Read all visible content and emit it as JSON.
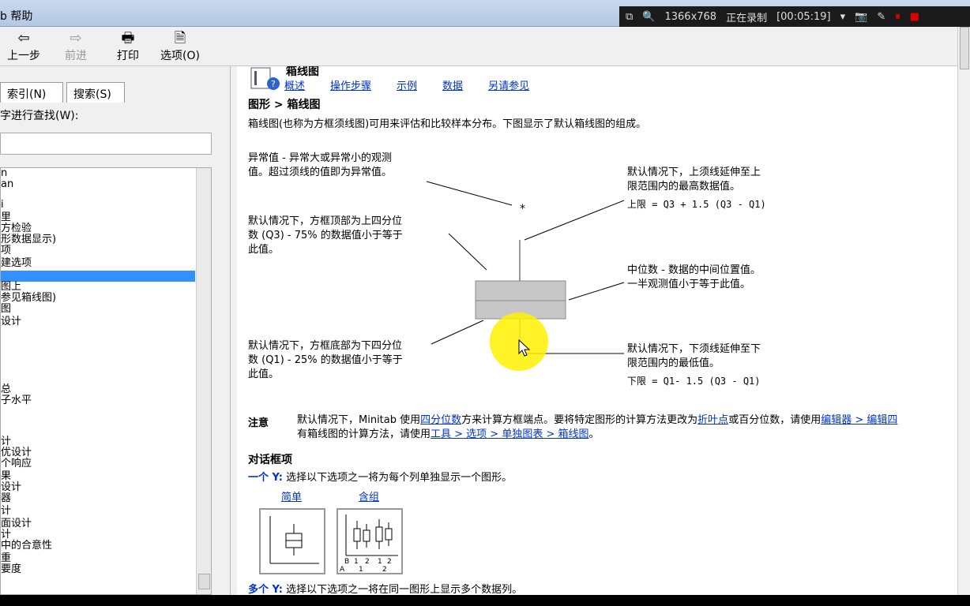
{
  "window": {
    "title": "b 帮助"
  },
  "recorder": {
    "resolution": "1366x768",
    "status": "正在录制",
    "elapsed": "[00:05:19]"
  },
  "toolbar": {
    "back": "上一步",
    "forward": "前进",
    "print": "打印",
    "options": "选项(O)"
  },
  "left": {
    "tabs": [
      "索引(N)",
      "搜索(S)"
    ],
    "find_label": "字进行查找(W):",
    "items": [
      "n",
      "an",
      "i",
      "里",
      "方检验",
      "形数据显示)",
      "项",
      "建选项",
      "",
      "图上",
      "参见箱线图)",
      "图",
      "设计",
      "",
      "总",
      "子水平",
      "",
      "计",
      "优设计",
      "个响应",
      "果",
      "设计",
      "器",
      "计",
      "面设计",
      "计",
      "中的合意性",
      "重",
      "要度"
    ]
  },
  "content": {
    "page_title": "箱线图",
    "nav": [
      "概述",
      "操作步骤",
      "示例",
      "数据",
      "另请参见"
    ],
    "breadcrumb": "图形 > 箱线图",
    "intro": "箱线图(也称为方框须线图)可用来评估和比较样本分布。下图显示了默认箱线图的组成。",
    "outlier_1": "异常值 - 异常大或异常小的观测",
    "outlier_2": "值。超过须线的值即为异常值。",
    "q3_1": "默认情况下，方框顶部为上四分位",
    "q3_2": "数 (Q3) - 75% 的数据值小于等于",
    "q3_3": "此值。",
    "upper_1": "默认情况下，上须线延伸至上",
    "upper_2": "限范围内的最高数据值。",
    "upper_3": "上限 = Q3 + 1.5 (Q3 - Q1)",
    "median_1": "中位数 - 数据的中间位置值。",
    "median_2": "一半观测值小于等于此值。",
    "q1_1": "默认情况下，方框底部为下四分位",
    "q1_2": "数 (Q1) - 25% 的数据值小于等于",
    "q1_3": "此值。",
    "lower_1": "默认情况下，下须线延伸至下",
    "lower_2": "限范围内的最低值。",
    "lower_3": "下限 = Q1- 1.5 (Q3 - Q1)",
    "note_label": "注意",
    "note_a": "默认情况下，Minitab 使用",
    "note_link1": "四分位数",
    "note_b": "方来计算方框端点。要将特定图形的计算方法更改为",
    "note_link2": "折叶点",
    "note_c": "或百分位数，请使用",
    "note_link3": "编辑器 > 编辑四",
    "note_d": "有箱线图的计算方法，请使用",
    "note_link4": "工具 > 选项 > 单独图表 > 箱线图",
    "note_e": "。",
    "dialog_title": "对话框项",
    "one_y": "一个 Y:",
    "one_y_desc": "选择以下选项之一将为每个列单独显示一个图形。",
    "simple": "简单",
    "with_groups": "含组",
    "multi_y": "多个 Y:",
    "multi_y_desc": "选择以下选项之一将在同一图形上显示多个数据列。",
    "outlier_star": "*",
    "thumb_labels_x": [
      "B",
      "1",
      "2",
      "1",
      "2"
    ],
    "thumb_label_a": "A",
    "thumb_label_sub": [
      "1",
      "2"
    ]
  }
}
